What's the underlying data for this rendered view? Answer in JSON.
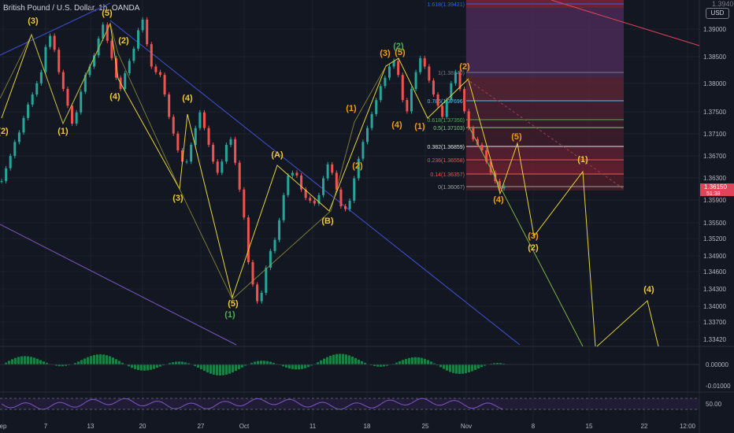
{
  "header": {
    "title": "British Pound / U.S. Dollar, 1h, OANDA",
    "currency_badge": "USD",
    "top_right_value": "1.39400"
  },
  "colors": {
    "background": "#131722",
    "grid": "#1e2230",
    "candle_up": "#26a69a",
    "candle_down": "#ef5350",
    "wave_line": "#e6d43a",
    "wave_label": "#f0c832",
    "wave_label_orange": "#f39c12",
    "sub_wave_label": "#4caf50",
    "channel_upper": "#3f51d6",
    "channel_lower": "#7e57c2",
    "trend_red": "#e0445a",
    "price_badge": "#e0445a",
    "fib_zone_top": "#6a2a3a",
    "fib_zone_mid": "#5c2734",
    "macd": "#1f8a4c",
    "rsi": "#7e57c2"
  },
  "chart_data": {
    "type": "line",
    "title": "British Pound / U.S. Dollar, 1h, OANDA",
    "y_axis": {
      "ticks": [
        "1.39000",
        "1.38500",
        "1.38000",
        "1.37500",
        "1.37100",
        "1.36700",
        "1.36300",
        "1.35900",
        "1.35500",
        "1.35200",
        "1.34900",
        "1.34600",
        "1.34300",
        "1.34000",
        "1.33700",
        "1.33420"
      ],
      "current_price": "1.36150",
      "current_time_left": "51:38",
      "ylim": [
        1.3342,
        1.3942
      ]
    },
    "x_axis": {
      "ticks": [
        "ep",
        "7",
        "13",
        "20",
        "27",
        "Oct",
        "11",
        "18",
        "25",
        "Nov",
        "8",
        "15",
        "22",
        "12:00"
      ]
    },
    "series": [
      {
        "values": [
          1.3625,
          1.3648,
          1.367,
          1.3695,
          1.3712,
          1.3738,
          1.3762,
          1.378,
          1.38,
          1.382,
          1.3865,
          1.3885,
          1.386,
          1.382,
          1.379,
          1.376,
          1.3728,
          1.3748,
          1.3785,
          1.3815,
          1.383,
          1.385,
          1.388,
          1.3905,
          1.3876,
          1.3845,
          1.381,
          1.379,
          1.3818,
          1.384,
          1.3862,
          1.3895,
          1.3914,
          1.387,
          1.383,
          1.382,
          1.3815,
          1.378,
          1.374,
          1.371,
          1.368,
          1.366,
          1.366,
          1.369,
          1.372,
          1.3748,
          1.372,
          1.369,
          1.366,
          1.364,
          1.366,
          1.369,
          1.37,
          1.3658,
          1.361,
          1.356,
          1.348,
          1.344,
          1.341,
          1.3425,
          1.347,
          1.35,
          1.352,
          1.3555,
          1.36,
          1.3635,
          1.364,
          1.3635,
          1.361,
          1.3595,
          1.359,
          1.3585,
          1.36,
          1.363,
          1.3655,
          1.364,
          1.361,
          1.358,
          1.3575,
          1.359,
          1.363,
          1.3665,
          1.3695,
          1.372,
          1.3745,
          1.377,
          1.3795,
          1.381,
          1.383,
          1.384,
          1.3815,
          1.377,
          1.375,
          1.379,
          1.382,
          1.3845,
          1.383,
          1.3805,
          1.378,
          1.376,
          1.374,
          1.377,
          1.38,
          1.382,
          1.379,
          1.375,
          1.372,
          1.37,
          1.369,
          1.368,
          1.366,
          1.364,
          1.3625,
          1.3612,
          1.3615
        ]
      }
    ],
    "fib_levels": [
      {
        "label": "1.618(1.39421)",
        "value": 1.39421,
        "color": "#2962ff"
      },
      {
        "label": "1(1.38140)",
        "value": 1.3814,
        "color": "#787b86"
      },
      {
        "label": "0.786(1.37696)",
        "value": 1.37696,
        "color": "#4fc3f7"
      },
      {
        "label": "0.618(1.37350)",
        "value": 1.3735,
        "color": "#4caf50"
      },
      {
        "label": "0.5(1.37103)",
        "value": 1.37103,
        "color": "#81c784"
      },
      {
        "label": "0.382(1.36859)",
        "value": 1.36859,
        "color": "#e0e0e0"
      },
      {
        "label": "0.236(1.36558)",
        "value": 1.36558,
        "color": "#ef5350"
      },
      {
        "label": "0.14(1.36357)",
        "value": 1.36357,
        "color": "#ef5350"
      },
      {
        "label": "0(1.36067)",
        "value": 1.36067,
        "color": "#9e9e9e"
      }
    ],
    "wave_labels": [
      {
        "text": "(3)",
        "color": "#f0c832"
      },
      {
        "text": "(5)",
        "color": "#f0c832"
      },
      {
        "text": "(2)",
        "color": "#f0c832"
      },
      {
        "text": "(2)",
        "color": "#f0c832"
      },
      {
        "text": "(4)",
        "color": "#f0c832"
      },
      {
        "text": "(1)",
        "color": "#f0c832"
      },
      {
        "text": "(4)",
        "color": "#f0c832"
      },
      {
        "text": "(3)",
        "color": "#f0c832"
      },
      {
        "text": "(5)",
        "color": "#f0c832"
      },
      {
        "text": "(1)",
        "color": "#4caf50"
      },
      {
        "text": "(A)",
        "color": "#f0c832"
      },
      {
        "text": "(B)",
        "color": "#f0c832"
      },
      {
        "text": "(1)",
        "color": "#f39c12"
      },
      {
        "text": "(2)",
        "color": "#f39c12"
      },
      {
        "text": "(3)",
        "color": "#f39c12"
      },
      {
        "text": "(5)",
        "color": "#f39c12"
      },
      {
        "text": "(2)",
        "color": "#4caf50"
      },
      {
        "text": "(4)",
        "color": "#f39c12"
      },
      {
        "text": "(1)",
        "color": "#f39c12"
      },
      {
        "text": "(2)",
        "color": "#f39c12"
      },
      {
        "text": "(4)",
        "color": "#f39c12"
      },
      {
        "text": "(3)",
        "color": "#f39c12"
      },
      {
        "text": "(5)",
        "color": "#f39c12"
      },
      {
        "text": "(1)",
        "color": "#f0c832"
      },
      {
        "text": "(2)",
        "color": "#f0c832"
      },
      {
        "text": "(4)",
        "color": "#f0c832"
      }
    ],
    "macd_ticks": [
      "0.00000",
      "-0.01000"
    ],
    "rsi_ticks": [
      "50.00"
    ]
  }
}
